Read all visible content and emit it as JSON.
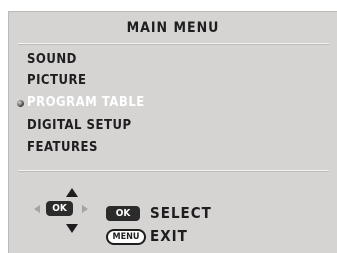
{
  "menu": {
    "title": "MAIN MENU",
    "items": [
      {
        "label": "SOUND",
        "active": false
      },
      {
        "label": "PICTURE",
        "active": false
      },
      {
        "label": "PROGRAM TABLE",
        "active": true
      },
      {
        "label": "DIGITAL SETUP",
        "active": false
      },
      {
        "label": "FEATURES",
        "active": false
      }
    ]
  },
  "legend": {
    "ok_key": "OK",
    "select_label": "SELECT",
    "menu_key": "MENU",
    "exit_label": "EXIT"
  },
  "colors": {
    "panel": "#d6d3d3",
    "text": "#1e1e1e",
    "highlight_text": "#ffffff"
  }
}
